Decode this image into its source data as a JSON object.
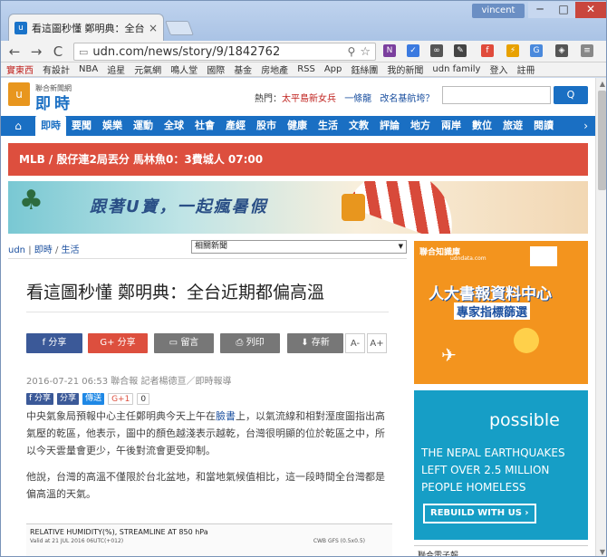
{
  "browser": {
    "tab_title": "看這圖秒懂 鄭明典：全台",
    "tab_close": "×",
    "profile": "vincent",
    "url": "udn.com/news/story/9/1842762",
    "min": "─",
    "max": "□",
    "close": "✕",
    "back": "←",
    "forward": "→",
    "reload": "C"
  },
  "bookmarks": [
    "實東西",
    "有設計",
    "NBA",
    "追星",
    "元氣網",
    "鳴人堂",
    "國際",
    "基金",
    "房地產",
    "RSS",
    "App",
    "鈺絲團",
    "我的新聞",
    "udn family",
    "登入",
    "註冊"
  ],
  "header": {
    "logo_top": "聯合新聞網",
    "logo_main": "即時",
    "hot_label": "熱門：",
    "hot_item1": "太平島新女兵",
    "hot_item2": "一條龍",
    "hot_item3": "改名基航垮？",
    "search_button": "Q"
  },
  "mainnav": {
    "items": [
      "即時",
      "要聞",
      "娛樂",
      "運動",
      "全球",
      "社會",
      "產經",
      "股市",
      "健康",
      "生活",
      "文教",
      "評論",
      "地方",
      "兩岸",
      "數位",
      "旅遊",
      "閱讀"
    ]
  },
  "breaking": "MLB / 殷仔連2局丟分 馬林魚0：3費城人 07:00",
  "banner": {
    "text": "跟著U寶，一起瘋暑假"
  },
  "breadcrumb": {
    "a": "udn",
    "b": "即時",
    "c": "生活"
  },
  "related_select": "相關新聞",
  "article": {
    "headline": "看這圖秒懂 鄭明典：全台近期都偏高溫",
    "buttons": {
      "fb": "分享",
      "gplus": "分享",
      "comment": "留言",
      "print": "列印",
      "save": "存新",
      "font_minus": "A-",
      "font_plus": "A+"
    },
    "meta": "2016-07-21 06:53 聯合報 記者楊德亘／即時報導",
    "social": {
      "fb": "分享",
      "fb2": "分享",
      "line": "傳送",
      "gplus": "G+1",
      "count": "0"
    },
    "para1_a": "中央氣象局預報中心主任鄭明典今天上午在",
    "para1_link": "臉書",
    "para1_b": "上，以氣流線和相對溼度圖指出高氣壓的乾區，他表示，圖中的顏色越淺表示越乾，台灣很明顯的位於乾區之中，所以今天雲量會更少，午後對流會更受抑制。",
    "para2": "他說，台灣的高溫不僅限於台北盆地，和當地氣候值相比，這一段時間全台灣都是偏高溫的天氣。",
    "chart_title": "RELATIVE HUMIDITY(%), STREAMLINE AT 850 hPa",
    "chart_valid": "Valid at 21 JUL 2016 06UTC(+012)",
    "chart_src": "CWB GFS (0.5x0.5)"
  },
  "ads": {
    "ad1_top": "聯合知識庫",
    "ad1_url": "udndata.com",
    "ad1_big": "人大書報資料中心",
    "ad1_sub": "專家指標篩選",
    "ad2_brand": "possible",
    "ad2_text": "THE NEPAL EARTHQUAKES LEFT OVER 2.5 MILLION PEOPLE HOMELESS",
    "ad2_button": "REBUILD WITH US ›",
    "ad3": "聯合電子報"
  }
}
